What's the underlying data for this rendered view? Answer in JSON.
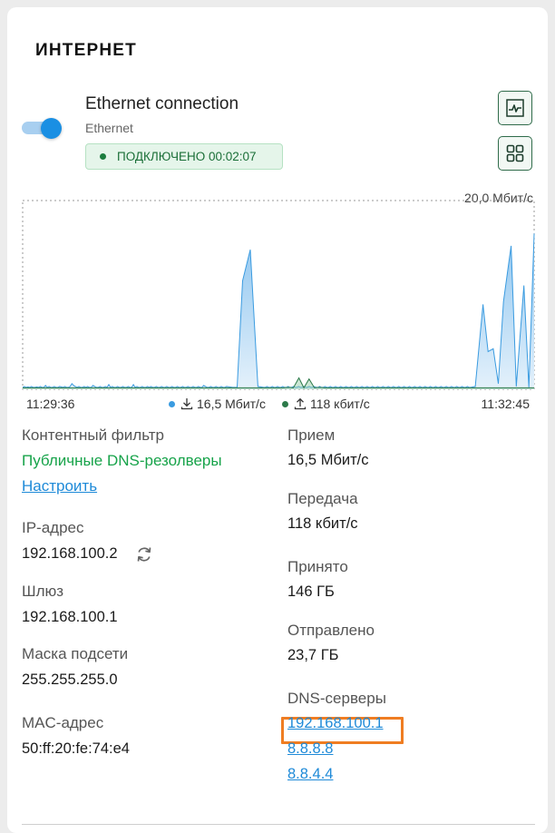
{
  "section": {
    "title": "ИНТЕРНЕТ"
  },
  "connection": {
    "name": "Ethernet connection",
    "type": "Ethernet",
    "enabled": true,
    "status": "ПОДКЛЮЧЕНО 00:02:07"
  },
  "buttons": {
    "graph_icon": "line-chart-icon",
    "apps_icon": "grid-icon"
  },
  "chart": {
    "max_label": "20,0 Мбит/с",
    "start_time": "11:29:36",
    "end_time": "11:32:45",
    "rx_label": "16,5 Мбит/с",
    "tx_label": "118 кбит/с",
    "rx_color": "#3a9be0",
    "tx_color": "#2d7a4a"
  },
  "chart_data": {
    "type": "area",
    "ylim": [
      0,
      20.0
    ],
    "x_range": [
      "11:29:36",
      "11:32:45"
    ],
    "grid": false,
    "series": [
      {
        "name": "16,5 Мбит/с",
        "values": [
          0.2,
          0.3,
          0.2,
          0.25,
          0.2,
          0.3,
          0.2,
          0.2,
          0.25,
          0.2,
          0.3,
          0.2,
          0.2,
          0.4,
          0.2,
          0.3,
          0.2,
          0.2,
          0.3,
          0.2,
          0.2,
          0.3,
          0.25,
          0.2,
          0.3,
          0.2,
          0.2,
          0.3,
          0.6,
          0.4,
          0.3,
          0.2,
          0.3,
          0.2,
          0.2,
          0.3,
          0.2,
          0.3,
          0.2,
          0.2,
          0.4,
          0.3,
          0.2,
          0.2,
          0.3,
          0.2,
          0.2,
          0.3,
          0.2,
          0.5,
          0.2,
          0.3,
          0.2,
          0.2,
          0.3,
          0.2,
          0.2,
          0.3,
          0.2,
          0.2,
          0.3,
          0.2,
          0.2,
          0.5,
          0.2,
          0.3,
          0.2,
          0.2,
          0.3,
          0.2,
          0.2,
          0.3,
          0.2,
          0.3,
          0.2,
          0.2,
          0.3,
          0.2,
          0.2,
          0.3,
          0.2,
          0.2,
          0.3,
          0.2,
          0.2,
          0.3,
          0.2,
          0.2,
          0.3,
          0.2,
          0.2,
          0.3,
          0.2,
          0.2,
          0.3,
          0.2,
          0.2,
          0.3,
          0.2,
          0.2,
          0.3,
          0.2,
          0.2,
          0.4,
          0.3,
          0.2,
          0.2,
          0.3,
          0.2,
          0.2,
          0.3,
          0.2,
          0.2,
          0.3,
          0.2,
          0.2,
          0.3,
          0.2,
          0.2,
          0.5,
          0.2,
          0.3,
          0.2,
          0.2,
          0.3,
          0.2,
          0.2,
          0.3,
          0.2,
          0.2,
          0.3,
          0.2,
          0.2,
          0.3,
          0.2,
          0.2,
          0.3,
          0.2,
          0.2,
          0.3,
          0.2,
          0.2,
          0.3,
          0.2,
          0.2,
          0.3,
          0.2,
          0.2,
          0.3,
          0.2,
          0.2,
          0.3,
          0.2,
          0.2,
          0.3,
          0.2,
          0.2,
          0.3,
          0.2,
          0.2,
          0.3,
          0.2,
          0.2,
          0.3,
          0.2,
          0.2,
          0.3,
          0.2,
          0.2,
          0.3,
          0.2,
          0.2,
          0.3,
          0.2,
          0.2,
          0.3,
          0.2,
          0.2,
          0.3,
          0.2,
          0.2,
          0.3,
          0.2,
          0.2,
          0.3,
          0.2,
          0.2,
          0.3,
          0.2,
          0.2,
          0.3,
          0.2,
          0.2,
          0.3,
          0.2,
          0.2,
          0.3,
          0.2,
          0.2,
          0.3,
          0.2,
          0.2,
          0.3,
          0.2,
          0.2,
          0.3,
          0.2,
          0.2,
          0.3,
          0.2,
          0.2,
          0.3,
          0.2,
          0.2,
          0.3,
          0.2,
          0.2,
          0.3,
          0.2,
          0.2,
          0.3,
          0.2,
          0.2,
          0.3,
          0.2,
          0.2,
          0.3,
          0.2,
          0.2,
          0.3,
          0.2,
          0.2,
          0.3,
          0.2,
          0.2,
          0.3,
          0.2,
          0.2,
          0.3,
          0.2,
          0.2,
          0.3,
          0.2,
          0.2,
          0.3,
          0.2,
          0.2,
          0.3,
          0.2,
          0.2,
          0.3,
          0.2,
          0.2,
          0.3,
          0.2,
          0.2,
          0.3,
          0.2,
          0.2,
          0.3,
          0.2,
          0.2,
          0.3,
          0.2,
          0.2,
          0.3,
          0.2,
          0.2,
          0.3,
          0.2,
          0.2,
          0.3,
          0.2,
          0.2,
          0.3,
          0.2,
          0.2,
          0.3,
          0.2,
          0.2,
          0.3,
          0.2,
          0.2,
          0.3,
          0.2,
          0.2,
          0.3,
          0.2,
          0.2,
          0.3,
          0.2,
          0.2
        ]
      },
      {
        "name": "118 кбит/с",
        "values": []
      }
    ],
    "spikes_rx": [
      {
        "t": 0.41,
        "v": 0.2
      },
      {
        "t": 0.43,
        "v": 11.5
      },
      {
        "t": 0.445,
        "v": 14.8
      },
      {
        "t": 0.46,
        "v": 0.3
      },
      {
        "t": 0.885,
        "v": 0.3
      },
      {
        "t": 0.9,
        "v": 9.0
      },
      {
        "t": 0.91,
        "v": 4.0
      },
      {
        "t": 0.92,
        "v": 4.3
      },
      {
        "t": 0.93,
        "v": 0.6
      },
      {
        "t": 0.94,
        "v": 9.3
      },
      {
        "t": 0.955,
        "v": 15.2
      },
      {
        "t": 0.965,
        "v": 0.3
      },
      {
        "t": 0.98,
        "v": 11.0
      },
      {
        "t": 1.0,
        "v": 16.5
      }
    ],
    "spikes_tx": [
      {
        "t": 0.52,
        "v": 0.2
      },
      {
        "t": 0.54,
        "v": 1.2
      },
      {
        "t": 0.56,
        "v": 1.1
      },
      {
        "t": 0.58,
        "v": 0.2
      }
    ]
  },
  "left": {
    "content_filter_label": "Контентный фильтр",
    "content_filter_value": "Публичные DNS-резолверы",
    "configure_link": "Настроить",
    "ip_label": "IP-адрес",
    "ip_value": "192.168.100.2",
    "gateway_label": "Шлюз",
    "gateway_value": "192.168.100.1",
    "mask_label": "Маска подсети",
    "mask_value": "255.255.255.0",
    "mac_label": "MAC-адрес",
    "mac_value": "50:ff:20:fe:74:e4"
  },
  "right": {
    "rx_label": "Прием",
    "rx_value": "16,5 Мбит/с",
    "tx_label": "Передача",
    "tx_value": "118 кбит/с",
    "received_label": "Принято",
    "received_value": "146 ГБ",
    "sent_label": "Отправлено",
    "sent_value": "23,7 ГБ",
    "dns_label": "DNS-серверы",
    "dns_servers": [
      "192.168.100.1",
      "8.8.8.8",
      "8.8.4.4"
    ]
  }
}
